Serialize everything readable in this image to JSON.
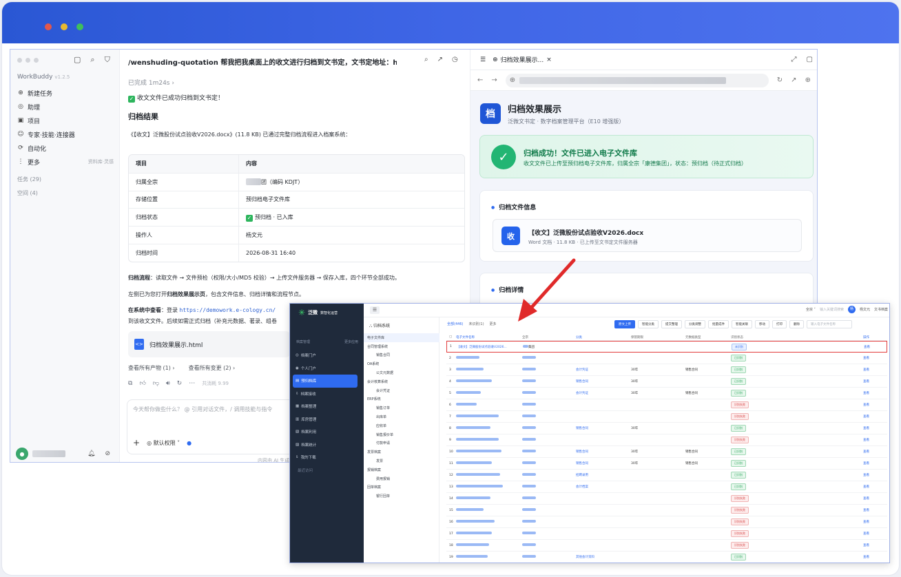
{
  "sidebar": {
    "brand": "WorkBuddy",
    "version": "v1.2.5",
    "items": [
      {
        "icon": "⊕",
        "label": "新建任务",
        "extra": ""
      },
      {
        "icon": "◎",
        "label": "助理",
        "extra": ""
      },
      {
        "icon": "▣",
        "label": "项目",
        "extra": ""
      },
      {
        "icon": "☺",
        "label": "专家·技能·连接器",
        "extra": ""
      },
      {
        "icon": "⟳",
        "label": "自动化",
        "extra": ""
      },
      {
        "icon": "⋮",
        "label": "更多",
        "extra": "资料库·灵感"
      }
    ],
    "group_tasks": "任务 (29)",
    "group_space": "空间 (4)"
  },
  "chat": {
    "title": "/wenshuding-quotation 帮我把我桌面上的收文进行归档到文书定，文书定地址：htt...",
    "done": "已完成 1m24s",
    "ok_msg": "收文文件已成功归档到文书定！",
    "heading": "归档结果",
    "desc": "《【收文】泛微股份试点验收V2026.docx》(11.8 KB) 已通过完整归档流程进入档案系统：",
    "table_head": [
      "项目",
      "内容"
    ],
    "table_rows": [
      [
        "归属全宗",
        "团（编码 KDJT）"
      ],
      [
        "存储位置",
        "预归档电子文件库"
      ],
      [
        "归档状态",
        "预归档 · 已入库"
      ],
      [
        "操作人",
        "杨文元"
      ],
      [
        "归档时间",
        "2026-08-31 16:40"
      ]
    ],
    "flow_label": "归档流程",
    "flow_text": "：读取文件 → 文件预检（权限/大小/MD5 校验）→ 上传文件服务器 → 保存入库，四个环节全部成功。",
    "open_text_a": "左侧已为您打开",
    "open_text_b": "归档效果展示页",
    "open_text_c": "，包含文件信息、归档详情和流程节点。",
    "view_label": "在系统中查看",
    "view_text": "：登录",
    "view_url": "https://demowork.e-cology.cn/",
    "view_text2": "到该收文文件。后续如需正式归档（补充元数据、著录、组卷",
    "file_card": "归档效果展示.html",
    "link_artifacts": "查看所有产物 (1) ›",
    "link_changes": "查看所有变更 (2) ›",
    "cost": "共消耗 9.99",
    "input_placeholder": "今天帮你做些什么？ @ 引用对话文件，/ 调用技能与指令",
    "permission": "默认权限",
    "footer": "内容由 AI 生成"
  },
  "preview": {
    "tab_title": "归档效果展示...",
    "page_title": "归档效果展示",
    "page_sub": "泛微文书定 · 数字档案管理平台（E10 增强版）",
    "logo": "档",
    "success_title": "归档成功！文件已进入电子文件库",
    "success_text": "收文文件已上传至预归档电子文件库，归属全宗「康德集团」，状态：预归档（待正式归档）",
    "info_title": "归档文件信息",
    "file_icon": "收",
    "file_name": "【收文】泛微股份试点验收V2026.docx",
    "file_meta": "Word 文档 · 11.8 KB · 已上传至文书定文件服务器",
    "detail_title": "归档详情"
  },
  "erp": {
    "logo": "泛微",
    "logo_sub": "数智化运营",
    "nav_section": "档案管理",
    "nav_section_r": "更多应用",
    "nav": [
      "档案门户",
      "个人门户",
      "预归档库",
      "档案接收",
      "档案整理",
      "库房管理",
      "档案利用",
      "档案统计",
      "我的下载",
      "最近访问"
    ],
    "user": "杨文元",
    "user_r": "文书档案",
    "search": "输入关键词搜索",
    "tree_title": "归档系统",
    "tree": [
      "电子文件库",
      "合同管理系统",
      "销售合同",
      "OA系统",
      "公文元数据",
      "会计核算系统",
      "会计凭证",
      "ERP系统",
      "销售订单",
      "出库单",
      "应收单",
      "销售报价单",
      "付款申请",
      "发票档案",
      "发票",
      "报销档案",
      "费用报销",
      "回单档案",
      "银行回单"
    ],
    "tabs": [
      "全部(446)",
      "未识别(1)",
      "更多"
    ],
    "buttons": [
      "原文上传",
      "智能分类",
      "提交整理",
      "分类调整",
      "批量成件",
      "智能关联",
      "移动",
      "打印",
      "删除"
    ],
    "search_r": "输入电子文件名称",
    "columns": [
      "电子文件名称",
      "全宗",
      "分类",
      "保管期限",
      "元数据类型",
      "识别状态",
      "操作"
    ],
    "first_row_name": "【收文】泛微股份试点验收V2026...",
    "first_row_quan": "集团",
    "status_first": "未识别",
    "status_ok": "已识别",
    "status_fail": "识别失败",
    "op": "查看",
    "keep": "30年",
    "cls": [
      "会计凭证",
      "销售合同",
      "会计凭证",
      "销售合同",
      "销售合同",
      "销售合同",
      "招聘录用",
      "会计档案",
      "其他会计资料"
    ],
    "type": "销售合同"
  },
  "colors": {
    "accent": "#2f6bf0",
    "success": "#22b573",
    "arrow": "#e02a2a"
  }
}
